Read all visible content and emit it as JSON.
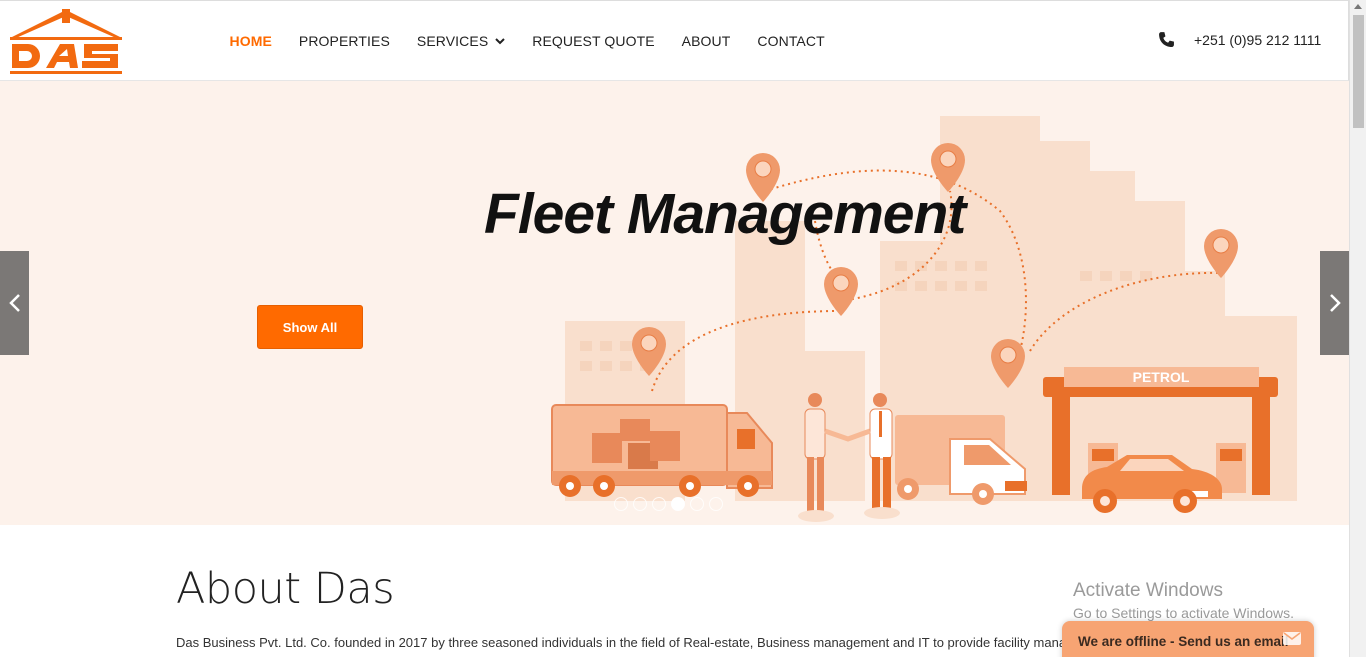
{
  "header": {
    "nav": [
      {
        "label": "HOME",
        "active": true
      },
      {
        "label": "PROPERTIES"
      },
      {
        "label": "SERVICES",
        "dropdown": true
      },
      {
        "label": "REQUEST QUOTE"
      },
      {
        "label": "ABOUT"
      },
      {
        "label": "CONTACT"
      }
    ],
    "phone": "+251 (0)95 212 1111"
  },
  "hero": {
    "title": "Fleet Management",
    "button_label": "Show All",
    "petrol_sign": "PETROL",
    "slide_count": 6,
    "active_slide": 4
  },
  "about": {
    "title": "About Das",
    "text_line1": "Das Business Pvt. Ltd. Co. founded in 2017 by three seasoned individuals in the field of Real-estate, Business management and IT to provide facility management",
    "text_line2": ""
  },
  "watermark": {
    "title": "Activate Windows",
    "subtitle": "Go to Settings to activate Windows."
  },
  "chat": {
    "label": "We are offline - Send us an email"
  },
  "colors": {
    "accent": "#ff6a00",
    "hero_bg": "#fdf2eb",
    "chat_bg": "#f7a473"
  }
}
